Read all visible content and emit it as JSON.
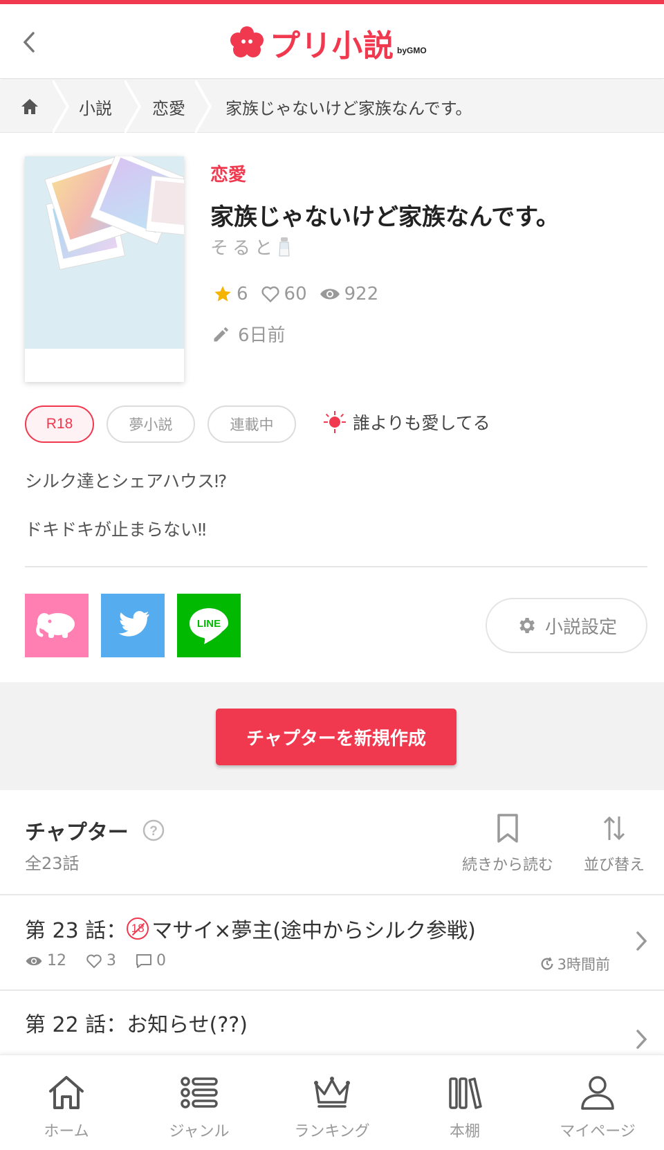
{
  "header": {
    "logo_text": "プリ小説",
    "logo_by": "byGMO"
  },
  "breadcrumb": {
    "items": [
      "小説",
      "恋愛",
      "家族じゃないけど家族なんです。"
    ]
  },
  "novel": {
    "genre": "恋愛",
    "title": "家族じゃないけど家族なんです。",
    "author": "そると",
    "stars": "6",
    "likes": "60",
    "views": "922",
    "updated": "6日前",
    "tags": [
      "R18",
      "夢小説",
      "連載中"
    ],
    "favorite_badge": "誰よりも愛してる",
    "description": [
      "シルク達とシェアハウス⁉",
      "ドキドキが止まらない‼"
    ]
  },
  "share": {
    "settings_label": "小説設定"
  },
  "create_button": "チャプターを新規作成",
  "chapters": {
    "heading": "チャプター",
    "count": "全23話",
    "continue_label": "続きから読む",
    "sort_label": "並び替え",
    "items": [
      {
        "title": "第 23 話：",
        "r18": "18",
        "subtitle": "マサイ×夢主(途中からシルク参戦)",
        "views": "12",
        "likes": "3",
        "comments": "0",
        "time": "3時間前"
      },
      {
        "title": "第 22 話：",
        "subtitle": "お知らせ(??)"
      }
    ]
  },
  "tabbar": {
    "items": [
      "ホーム",
      "ジャンル",
      "ランキング",
      "本棚",
      "マイページ"
    ]
  },
  "colors": {
    "accent": "#f0384f",
    "line_green": "#00b900",
    "twitter_blue": "#55acee",
    "pink": "#ff7fb3"
  }
}
